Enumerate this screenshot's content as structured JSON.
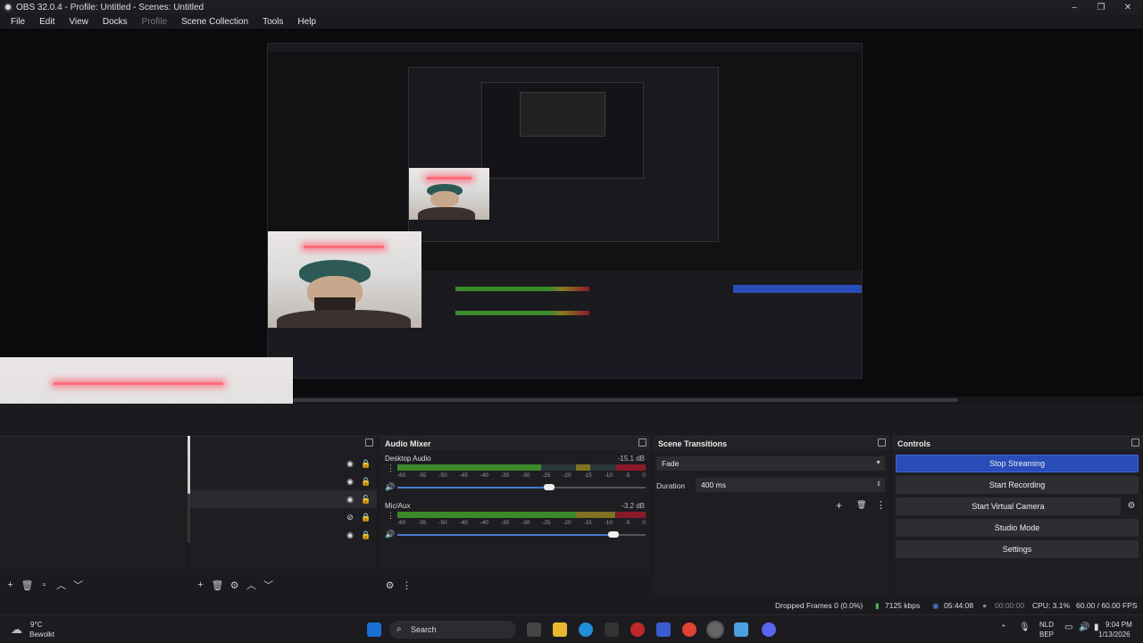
{
  "window": {
    "title": "OBS 32.0.4 - Profile: Untitled - Scenes: Untitled",
    "controls": {
      "minimize": "–",
      "maximize": "❐",
      "close": "✕"
    }
  },
  "menu": {
    "file": "File",
    "edit": "Edit",
    "view": "View",
    "docks": "Docks",
    "profile": "Profile",
    "scene_collection": "Scene Collection",
    "tools": "Tools",
    "help": "Help"
  },
  "audio_mixer": {
    "title": "Audio Mixer",
    "channels": [
      {
        "name": "Desktop Audio",
        "db": "-15.1 dB",
        "level": 0.58,
        "peak": 0.61,
        "volume": 0.61
      },
      {
        "name": "Mic/Aux",
        "db": "-3.2 dB",
        "level": 0.82,
        "peak": 0.84,
        "volume": 0.87
      }
    ],
    "ticks": [
      "-60",
      "-55",
      "-50",
      "-45",
      "-40",
      "-35",
      "-30",
      "-25",
      "-20",
      "-15",
      "-10",
      "-5",
      "0"
    ]
  },
  "scene_transitions": {
    "title": "Scene Transitions",
    "transition": "Fade",
    "duration_label": "Duration",
    "duration_value": "400 ms"
  },
  "controls": {
    "title": "Controls",
    "stop_streaming": "Stop Streaming",
    "start_recording": "Start Recording",
    "start_virtual_camera": "Start Virtual Camera",
    "studio_mode": "Studio Mode",
    "settings": "Settings"
  },
  "status": {
    "dropped_frames": "Dropped Frames 0 (0.0%)",
    "bitrate": "7125 kbps",
    "stream_time": "05:44:08",
    "rec_time": "00:00:00",
    "cpu": "CPU: 3.1%",
    "fps": "60.00 / 60.00 FPS"
  },
  "taskbar": {
    "weather_temp": "9°C",
    "weather_desc": "Bewolkt",
    "search": "Search",
    "lang_top": "NLD",
    "lang_bottom": "BEP",
    "time": "9:04 PM",
    "date": "1/13/2026"
  },
  "colors": {
    "accent": "#284cb8",
    "meter_green": "#3c8a2a",
    "meter_yellow": "#8a7a20",
    "meter_red": "#8a1a2a"
  }
}
